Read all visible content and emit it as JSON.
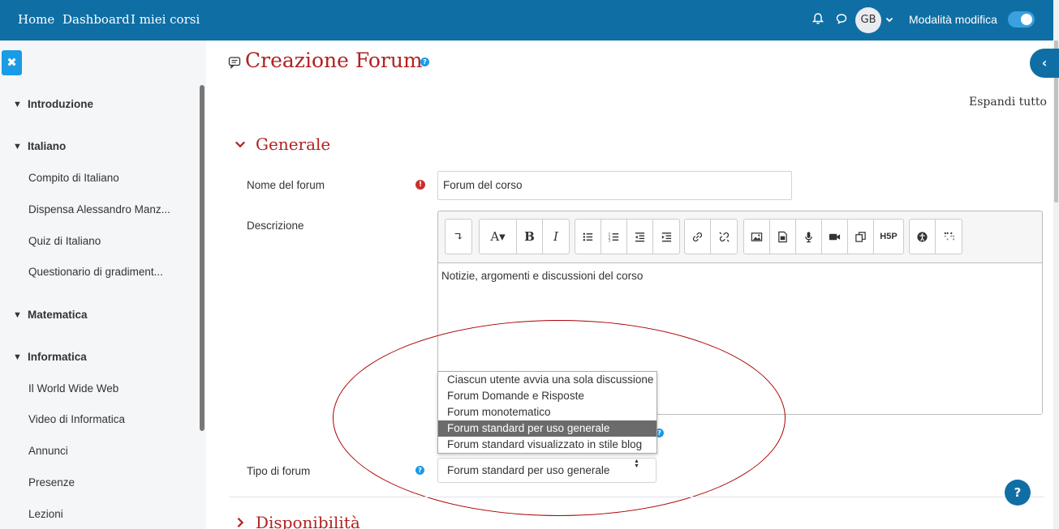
{
  "navbar": {
    "links": [
      "Home",
      "Dashboard",
      "I miei corsi"
    ],
    "avatar_initials": "GB",
    "edit_mode_label": "Modalità modifica",
    "edit_mode_on": true,
    "color": "#0f6fa5"
  },
  "drawer": {
    "sections": [
      {
        "title": "Introduzione",
        "activities": []
      },
      {
        "title": "Italiano",
        "activities": [
          "Compito di Italiano",
          "Dispensa Alessandro Manz...",
          "Quiz di Italiano",
          "Questionario di gradiment..."
        ]
      },
      {
        "title": "Matematica",
        "activities": []
      },
      {
        "title": "Informatica",
        "activities": [
          "Il World Wide Web",
          "Video di Informatica",
          "Annunci",
          "Presenze",
          "Lezioni"
        ]
      }
    ]
  },
  "main": {
    "page_title": "Creazione Forum",
    "expand_all": "Espandi tutto",
    "sections": {
      "generale": "Generale",
      "disponibilita": "Disponibilità"
    },
    "fields": {
      "name_label": "Nome del forum",
      "name_value": "Forum del corso",
      "description_label": "Descrizione",
      "description_value": "Notizie, argomenti e discussioni del corso",
      "type_label": "Tipo di forum",
      "type_value": "Forum standard per uso generale",
      "type_options": [
        "Ciascun utente avvia una sola discussione",
        "Forum Domande e Risposte",
        "Forum monotematico",
        "Forum standard per uso generale",
        "Forum standard visualizzato in stile blog"
      ],
      "type_selected_index": 3
    },
    "title_accent": "#b22222"
  }
}
